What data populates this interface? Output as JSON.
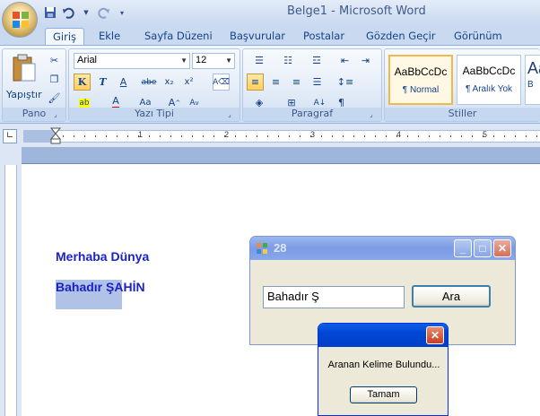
{
  "titlebar": {
    "doc_title": "Belge1 - Microsoft Word"
  },
  "quick_access": {
    "icons": [
      "save-icon",
      "undo-icon",
      "redo-icon",
      "customize-icon"
    ]
  },
  "tabs": [
    "Giriş",
    "Ekle",
    "Sayfa Düzeni",
    "Başvurular",
    "Postalar",
    "Gözden Geçir",
    "Görünüm"
  ],
  "active_tab": "Giriş",
  "ribbon": {
    "pano": {
      "label": "Pano",
      "paste_label": "Yapıştır"
    },
    "font": {
      "label": "Yazı Tipi",
      "font_name": "Arial",
      "font_size": "12"
    },
    "paragraph": {
      "label": "Paragraf"
    },
    "styles": {
      "label": "Stiller",
      "items": [
        {
          "sample": "AaBbCcDc",
          "name": "¶ Normal"
        },
        {
          "sample": "AaBbCcDc",
          "name": "¶ Aralık Yok"
        },
        {
          "sample": "Aa",
          "name": "B"
        }
      ]
    }
  },
  "ruler": {
    "numbers": [
      "1",
      "2",
      "3",
      "4",
      "5"
    ]
  },
  "document": {
    "lines": [
      "Merhaba Dünya",
      "Bahadır ŞAHİN"
    ]
  },
  "app_window": {
    "title": "28",
    "input_value": "Bahadır Ş",
    "button_label": "Ara"
  },
  "dialog": {
    "message": "Aranan Kelime Bulundu...",
    "button_label": "Tamam"
  },
  "colors": {
    "doc_text": "#1a22c8",
    "xp_title": "#0046d5",
    "ribbon_bg": "#dce6f4"
  }
}
